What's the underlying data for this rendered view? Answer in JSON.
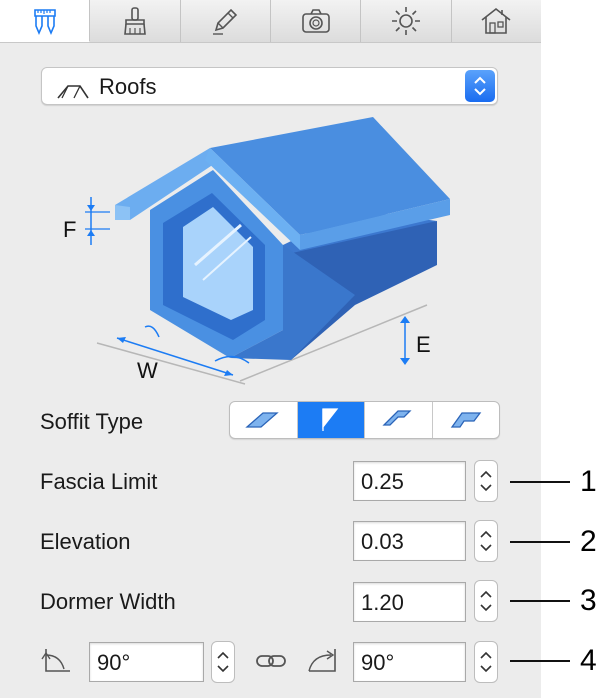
{
  "tabs": [
    {
      "icon": "caliper-icon",
      "active": true
    },
    {
      "icon": "brush-icon",
      "active": false
    },
    {
      "icon": "pencil-icon",
      "active": false
    },
    {
      "icon": "camera-icon",
      "active": false
    },
    {
      "icon": "sun-icon",
      "active": false
    },
    {
      "icon": "house-icon",
      "active": false
    }
  ],
  "dropdown": {
    "label": "Roofs",
    "icon": "roof-icon"
  },
  "diagram": {
    "label_f": "F",
    "label_w": "W",
    "label_e": "E"
  },
  "soffit": {
    "label": "Soffit Type",
    "selected_index": 1,
    "options": 4
  },
  "fields": {
    "fascia_limit": {
      "label": "Fascia Limit",
      "value": "0.25"
    },
    "elevation": {
      "label": "Elevation",
      "value": "0.03"
    },
    "dormer_width": {
      "label": "Dormer Width",
      "value": "1.20"
    },
    "angle_left": {
      "value": "90°"
    },
    "angle_right": {
      "value": "90°"
    }
  },
  "callouts": [
    "1",
    "2",
    "3",
    "4"
  ],
  "colors": {
    "accent": "#1c7cf4",
    "dormer_blue": "#4a90e2"
  }
}
